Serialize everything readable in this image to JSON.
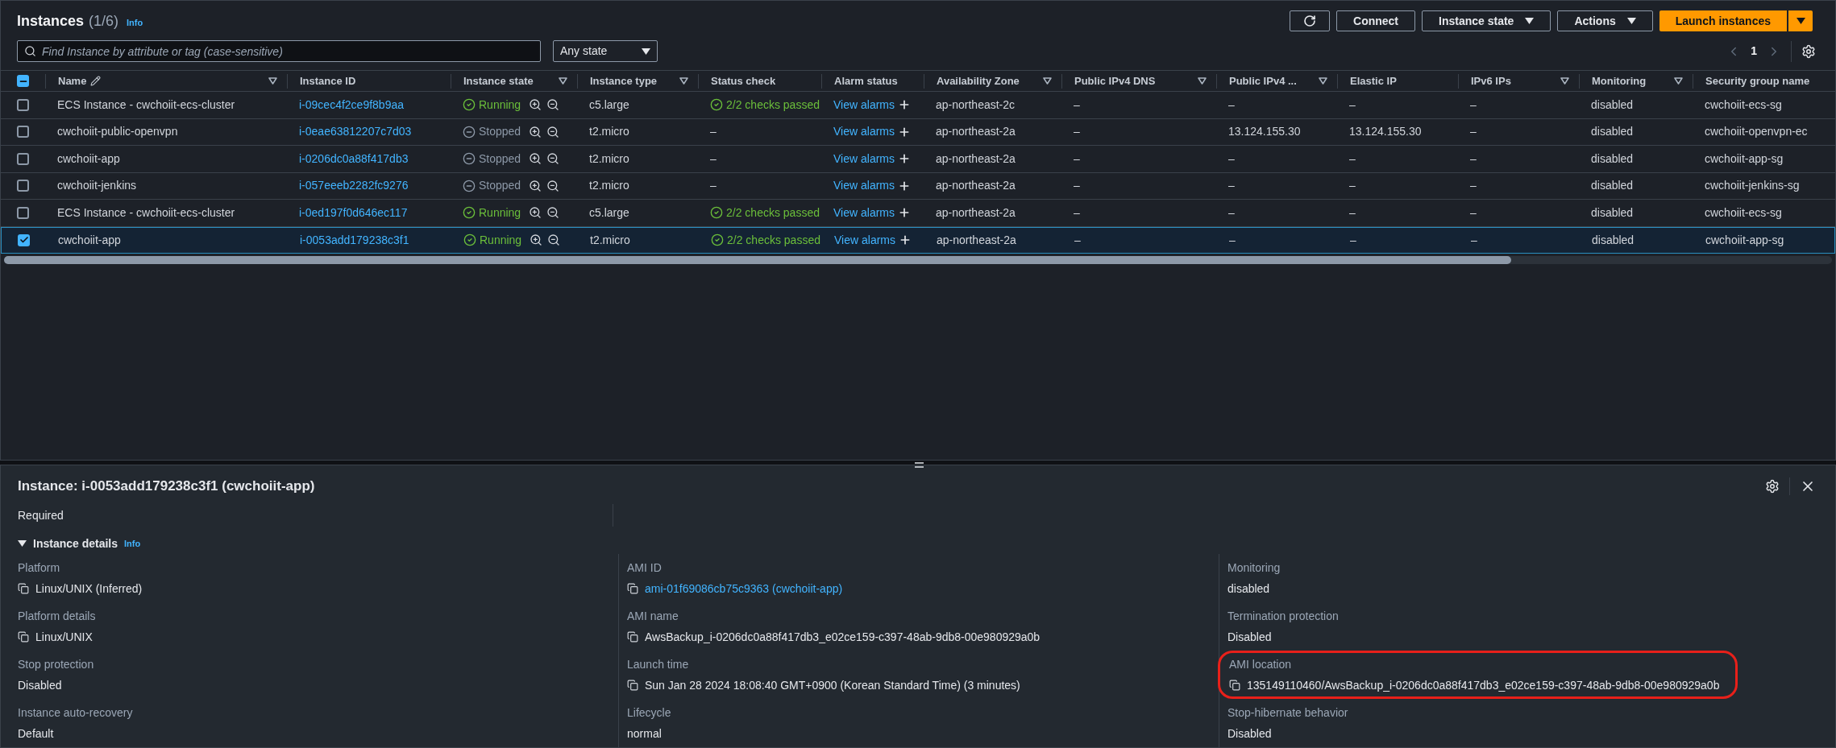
{
  "header": {
    "title": "Instances",
    "count": "(1/6)",
    "info": "Info"
  },
  "toolbar": {
    "buttons": [
      {
        "kind": "refresh"
      },
      {
        "kind": "plain",
        "label": "Connect"
      },
      {
        "kind": "dropdown",
        "label": "Instance state"
      },
      {
        "kind": "dropdown",
        "label": "Actions"
      }
    ],
    "launch": {
      "label": "Launch instances"
    }
  },
  "search": {
    "placeholder": "Find Instance by attribute or tag (case-sensitive)"
  },
  "state_filter": {
    "value": "Any state"
  },
  "pagination": {
    "page": "1"
  },
  "table": {
    "header_checkbox_partial": true,
    "columns": [
      {
        "label": "Name",
        "editable": true,
        "filter": true
      },
      {
        "label": "Instance ID",
        "editable": false,
        "filter": false
      },
      {
        "label": "Instance state",
        "editable": false,
        "filter": true
      },
      {
        "label": "Instance type",
        "editable": false,
        "filter": true
      },
      {
        "label": "Status check",
        "editable": false,
        "filter": false
      },
      {
        "label": "Alarm status",
        "editable": false,
        "filter": false
      },
      {
        "label": "Availability Zone",
        "editable": false,
        "filter": true
      },
      {
        "label": "Public IPv4 DNS",
        "editable": false,
        "filter": true
      },
      {
        "label": "Public IPv4 ...",
        "editable": false,
        "filter": true
      },
      {
        "label": "Elastic IP",
        "editable": false,
        "filter": false
      },
      {
        "label": "IPv6 IPs",
        "editable": false,
        "filter": true
      },
      {
        "label": "Monitoring",
        "editable": false,
        "filter": true
      },
      {
        "label": "Security group name",
        "editable": false
      }
    ],
    "rows": [
      {
        "selected": false,
        "name": "ECS Instance - cwchoiit-ecs-cluster",
        "instance_id": "i-09cec4f2ce9f8b9aa",
        "state": {
          "kind": "running",
          "label": "Running"
        },
        "type": "c5.large",
        "status_check": {
          "kind": "passed",
          "label": "2/2 checks passed"
        },
        "alarms": "View alarms",
        "az": "ap-northeast-2c",
        "dns": "–",
        "ipv4": "–",
        "elastic_ip": "–",
        "ipv6": "–",
        "monitoring": "disabled",
        "security_group": "cwchoiit-ecs-sg"
      },
      {
        "selected": false,
        "name": "cwchoiit-public-openvpn",
        "instance_id": "i-0eae63812207c7d03",
        "state": {
          "kind": "stopped",
          "label": "Stopped"
        },
        "type": "t2.micro",
        "status_check": {
          "kind": "none",
          "label": "–"
        },
        "alarms": "View alarms",
        "az": "ap-northeast-2a",
        "dns": "–",
        "ipv4": "13.124.155.30",
        "elastic_ip": "13.124.155.30",
        "ipv6": "–",
        "monitoring": "disabled",
        "security_group": "cwchoiit-openvpn-ec"
      },
      {
        "selected": false,
        "name": "cwchoiit-app",
        "instance_id": "i-0206dc0a88f417db3",
        "state": {
          "kind": "stopped",
          "label": "Stopped"
        },
        "type": "t2.micro",
        "status_check": {
          "kind": "none",
          "label": "–"
        },
        "alarms": "View alarms",
        "az": "ap-northeast-2a",
        "dns": "–",
        "ipv4": "–",
        "elastic_ip": "–",
        "ipv6": "–",
        "monitoring": "disabled",
        "security_group": "cwchoiit-app-sg"
      },
      {
        "selected": false,
        "name": "cwchoiit-jenkins",
        "instance_id": "i-057eeeb2282fc9276",
        "state": {
          "kind": "stopped",
          "label": "Stopped"
        },
        "type": "t2.micro",
        "status_check": {
          "kind": "none",
          "label": "–"
        },
        "alarms": "View alarms",
        "az": "ap-northeast-2a",
        "dns": "–",
        "ipv4": "–",
        "elastic_ip": "–",
        "ipv6": "–",
        "monitoring": "disabled",
        "security_group": "cwchoiit-jenkins-sg"
      },
      {
        "selected": false,
        "name": "ECS Instance - cwchoiit-ecs-cluster",
        "instance_id": "i-0ed197f0d646ec117",
        "state": {
          "kind": "running",
          "label": "Running"
        },
        "type": "c5.large",
        "status_check": {
          "kind": "passed",
          "label": "2/2 checks passed"
        },
        "alarms": "View alarms",
        "az": "ap-northeast-2a",
        "dns": "–",
        "ipv4": "–",
        "elastic_ip": "–",
        "ipv6": "–",
        "monitoring": "disabled",
        "security_group": "cwchoiit-ecs-sg"
      },
      {
        "selected": true,
        "name": "cwchoiit-app",
        "instance_id": "i-0053add179238c3f1",
        "state": {
          "kind": "running",
          "label": "Running"
        },
        "type": "t2.micro",
        "status_check": {
          "kind": "passed",
          "label": "2/2 checks passed"
        },
        "alarms": "View alarms",
        "az": "ap-northeast-2a",
        "dns": "–",
        "ipv4": "–",
        "elastic_ip": "–",
        "ipv6": "–",
        "monitoring": "disabled",
        "security_group": "cwchoiit-app-sg"
      }
    ]
  },
  "details": {
    "title": "Instance: i-0053add179238c3f1 (cwchoiit-app)",
    "required": "Required",
    "section": {
      "title": "Instance details",
      "info": "Info",
      "expanded": true
    },
    "columns": [
      [
        {
          "label": "Platform",
          "value": "Linux/UNIX (Inferred)",
          "copyable": true,
          "link": false,
          "highlighted": false
        },
        {
          "label": "Platform details",
          "value": "Linux/UNIX",
          "copyable": true,
          "link": false,
          "highlighted": false
        },
        {
          "label": "Stop protection",
          "value": "Disabled",
          "copyable": false,
          "link": false,
          "highlighted": false
        },
        {
          "label": "Instance auto-recovery",
          "value": "Default",
          "copyable": false,
          "link": false,
          "highlighted": false
        }
      ],
      [
        {
          "label": "AMI ID",
          "value": "ami-01f69086cb75c9363 (cwchoiit-app)",
          "copyable": true,
          "link": true,
          "highlighted": false
        },
        {
          "label": "AMI name",
          "value": "AwsBackup_i-0206dc0a88f417db3_e02ce159-c397-48ab-9db8-00e980929a0b",
          "copyable": true,
          "link": false,
          "highlighted": false
        },
        {
          "label": "Launch time",
          "value": "Sun Jan 28 2024 18:08:40 GMT+0900 (Korean Standard Time) (3 minutes)",
          "copyable": true,
          "link": false,
          "highlighted": false
        },
        {
          "label": "Lifecycle",
          "value": "normal",
          "copyable": false,
          "link": false,
          "highlighted": false
        }
      ],
      [
        {
          "label": "Monitoring",
          "value": "disabled",
          "copyable": false,
          "link": false,
          "highlighted": false
        },
        {
          "label": "Termination protection",
          "value": "Disabled",
          "copyable": false,
          "link": false,
          "highlighted": false
        },
        {
          "label": "AMI location",
          "value": "135149110460/AwsBackup_i-0206dc0a88f417db3_e02ce159-c397-48ab-9db8-00e980929a0b",
          "copyable": true,
          "link": false,
          "highlighted": true
        },
        {
          "label": "Stop-hibernate behavior",
          "value": "Disabled",
          "copyable": false,
          "link": false,
          "highlighted": false
        }
      ]
    ]
  }
}
